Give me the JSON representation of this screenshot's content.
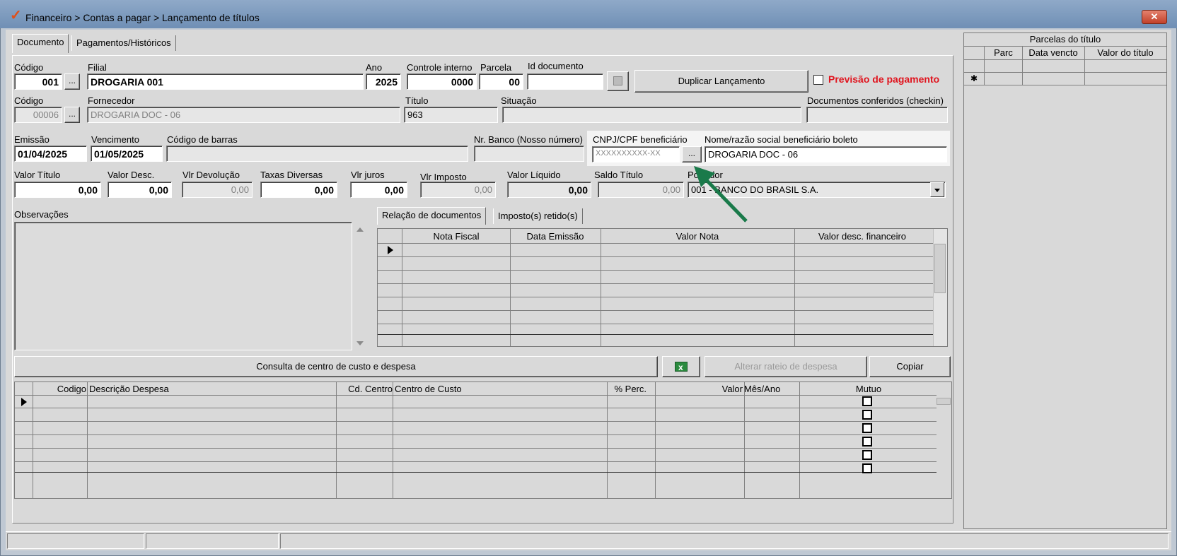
{
  "window": {
    "title": "Financeiro > Contas a pagar > Lançamento de títulos",
    "close_label": "✕"
  },
  "tabs": {
    "documento": "Documento",
    "pagamentos": "Pagamentos/Históricos"
  },
  "row1": {
    "codigo_label": "Código",
    "codigo_value": "001",
    "filial_label": "Filial",
    "filial_value": "DROGARIA 001",
    "ano_label": "Ano",
    "ano_value": "2025",
    "controle_label": "Controle interno",
    "controle_value": "0000",
    "parcela_label": "Parcela",
    "parcela_value": "00",
    "iddoc_label": "Id documento",
    "iddoc_value": "",
    "duplicar_label": "Duplicar Lançamento",
    "previsao_label": "Previsão de pagamento"
  },
  "row2": {
    "codigo_label": "Código",
    "codigo_value": "00006",
    "fornecedor_label": "Fornecedor",
    "fornecedor_value": "DROGARIA DOC - 06",
    "titulo_label": "Título",
    "titulo_value": "963",
    "situacao_label": "Situação",
    "situacao_value": "",
    "docs_conf_label": "Documentos conferidos (checkin)",
    "docs_conf_value": ""
  },
  "row3": {
    "emissao_label": "Emissão",
    "emissao_value": "01/04/2025",
    "vencimento_label": "Vencimento",
    "vencimento_value": "01/05/2025",
    "cod_barras_label": "Código de barras",
    "cod_barras_value": "",
    "nr_banco_label": "Nr. Banco (Nosso número)",
    "nr_banco_value": "",
    "cnpj_label": "CNPJ/CPF beneficiário",
    "cnpj_value": "XXXXXXXXXX-XX",
    "dots_label": "...",
    "nome_label": "Nome/razão social beneficiário boleto",
    "nome_value": "DROGARIA DOC - 06"
  },
  "row4": {
    "valor_titulo_label": "Valor Título",
    "valor_titulo_value": "0,00",
    "valor_desc_label": "Valor Desc.",
    "valor_desc_value": "0,00",
    "vlr_devolucao_label": "Vlr Devolução",
    "vlr_devolucao_value": "0,00",
    "taxas_label": "Taxas Diversas",
    "taxas_value": "0,00",
    "vlr_juros_label": "Vlr juros",
    "vlr_juros_value": "0,00",
    "vlr_imposto_label": "Vlr Imposto",
    "vlr_imposto_value": "0,00",
    "valor_liquido_label": "Valor Líquido",
    "valor_liquido_value": "0,00",
    "saldo_titulo_label": "Saldo Título",
    "saldo_titulo_value": "0,00",
    "portador_label": "Portador",
    "portador_value": "001 - BANCO DO BRASIL S.A."
  },
  "observacoes_label": "Observações",
  "doc_tabs": {
    "relacao": "Relação de documentos",
    "impostos": "Imposto(s) retido(s)"
  },
  "doc_grid": {
    "headers": [
      "Nota Fiscal",
      "Data Emissão",
      "Valor Nota",
      "Valor desc. financeiro"
    ]
  },
  "buttons": {
    "consulta": "Consulta de centro de custo e despesa",
    "alterar_rateio": "Alterar rateio de despesa",
    "copiar": "Copiar",
    "excel_icon": "excel-icon"
  },
  "expense_grid": {
    "headers": [
      "Codigo",
      "Descrição Despesa",
      "Cd. Centro",
      "Centro de Custo",
      "% Perc.",
      "Valor",
      "Mês/Ano",
      "Mutuo"
    ]
  },
  "parcelas": {
    "title": "Parcelas do título",
    "headers": [
      "Parc",
      "Data vencto",
      "Valor do título"
    ],
    "new_row_marker": "✱"
  },
  "colors": {
    "accent_red": "#e0141e",
    "arrow_green": "#1a7a4a"
  }
}
